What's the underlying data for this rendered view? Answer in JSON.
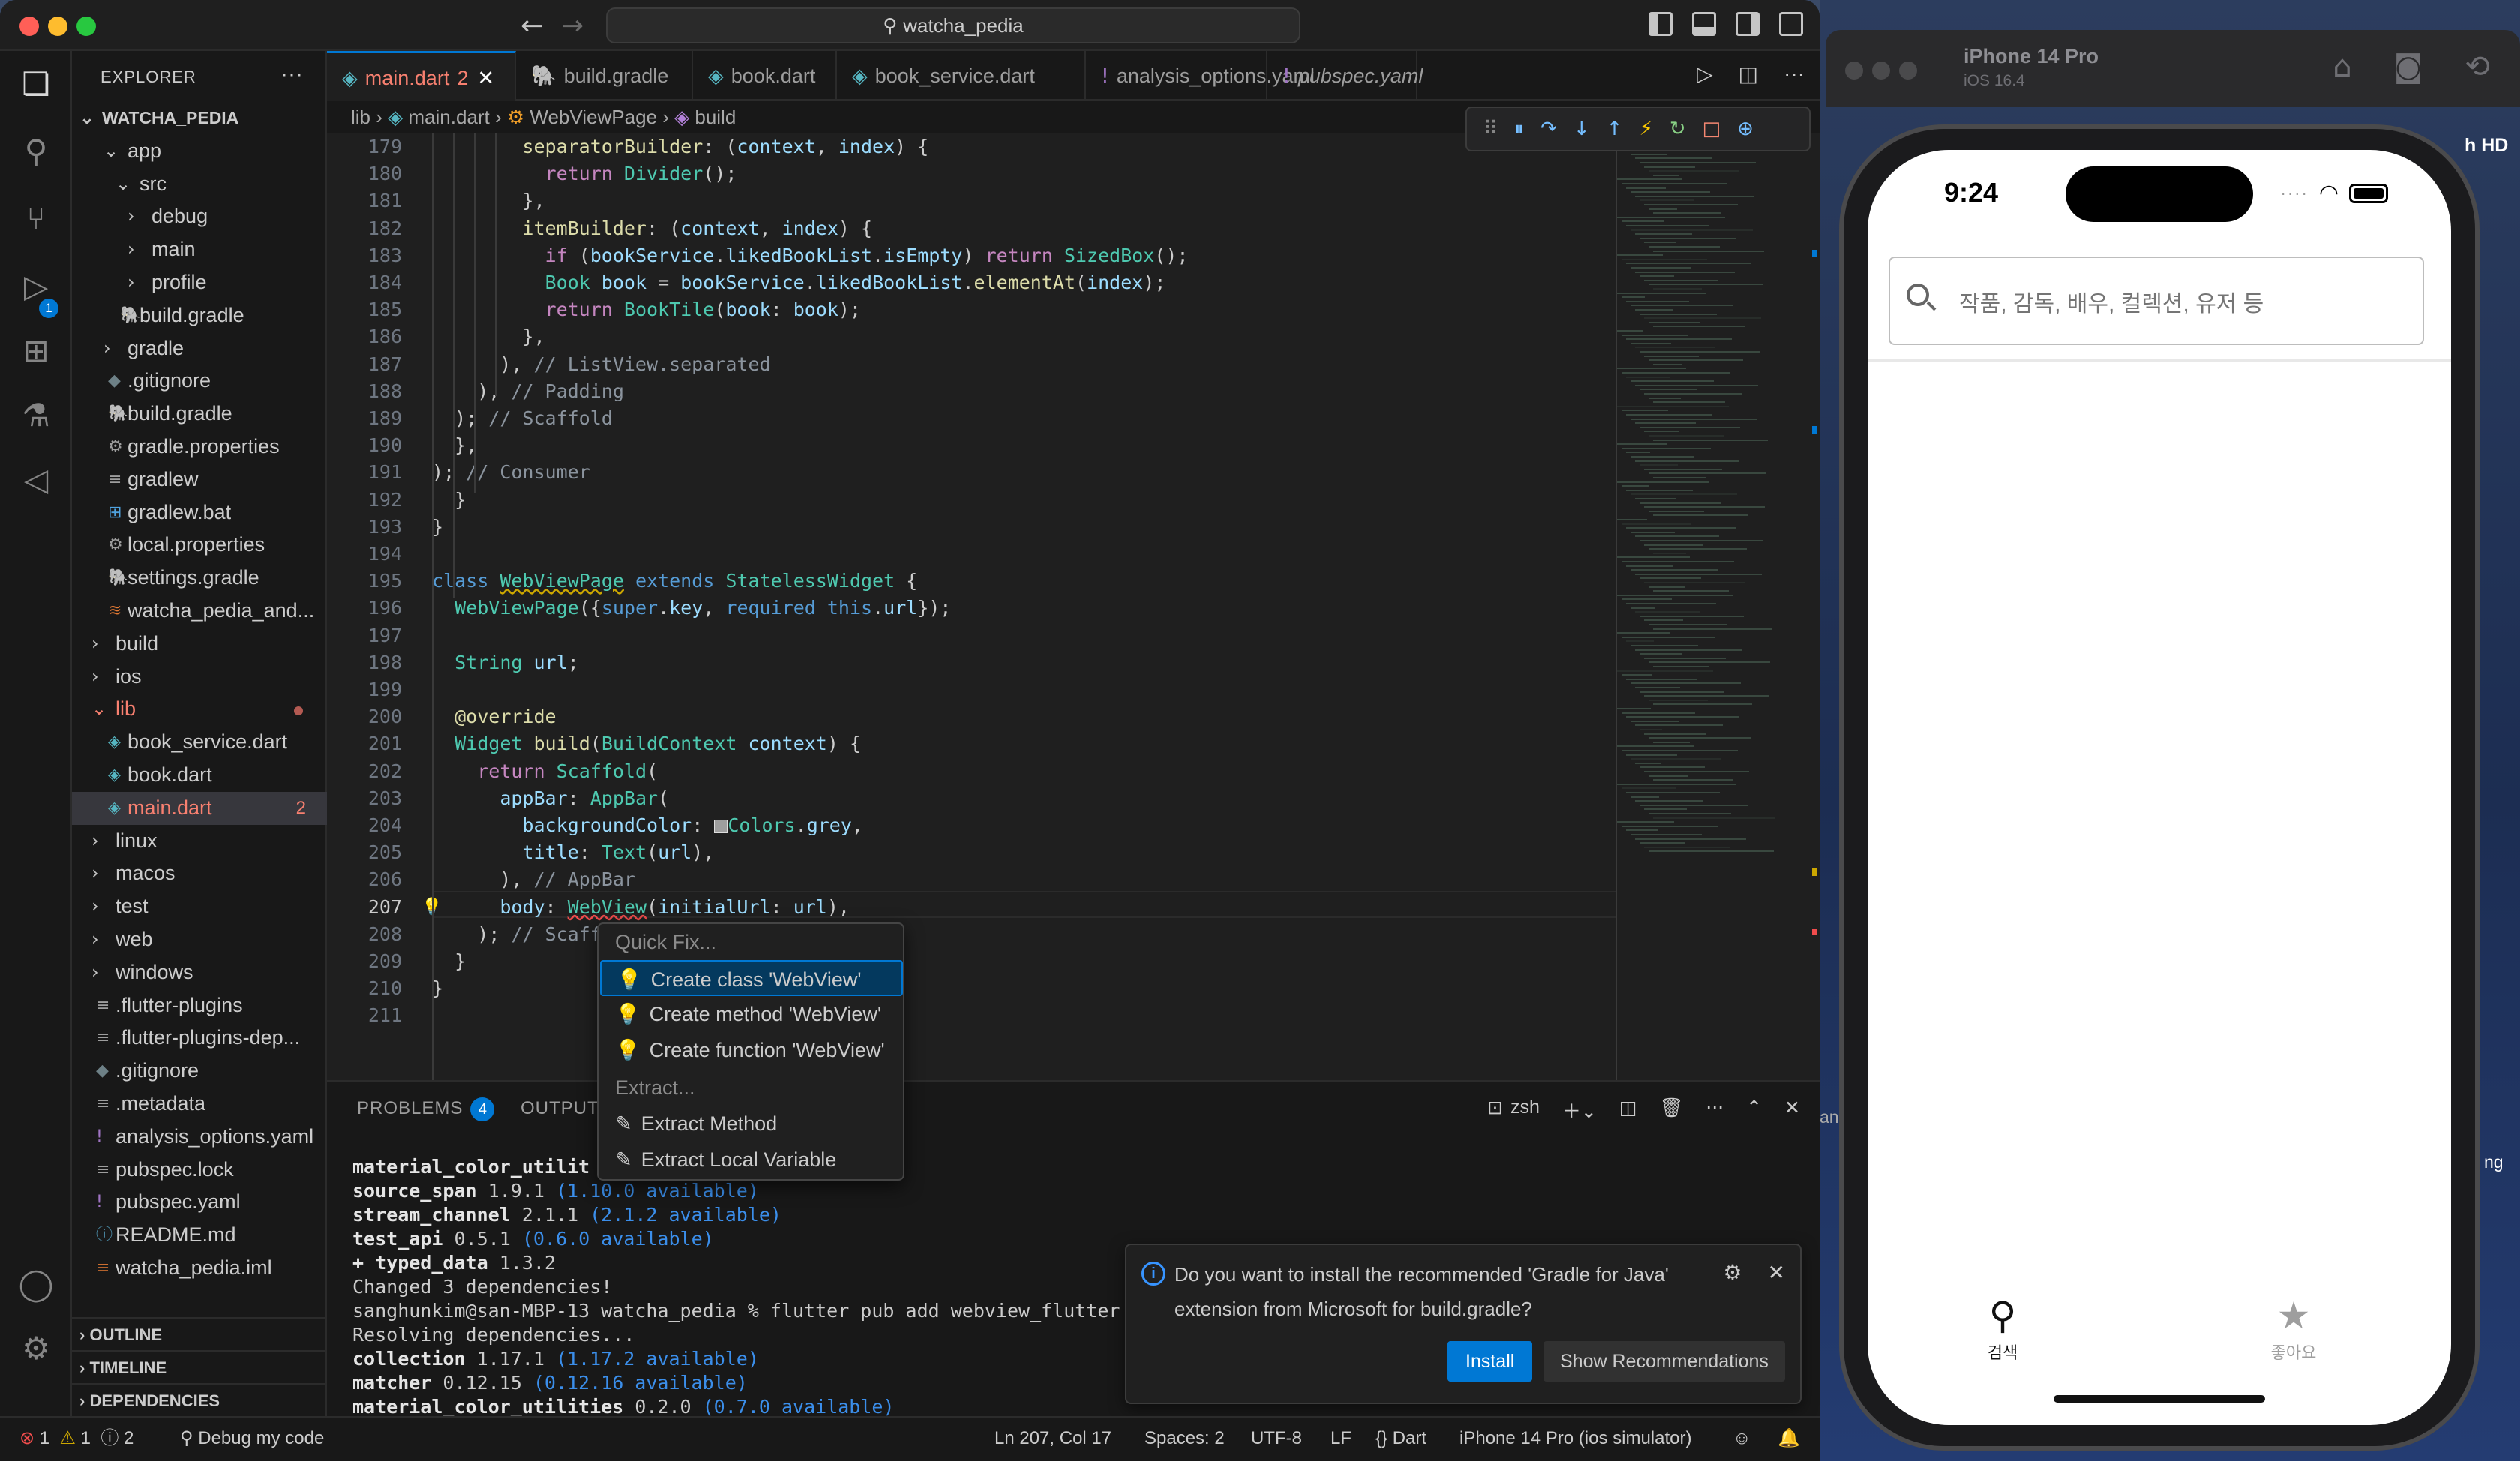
{
  "titlebar": {
    "command_center": "watcha_pedia",
    "back": "←",
    "forward": "→"
  },
  "explorer": {
    "header": "EXPLORER",
    "more": "···",
    "root": "WATCHA_PEDIA",
    "items": [
      {
        "label": "app",
        "indent": 1,
        "kind": "folder-open"
      },
      {
        "label": "src",
        "indent": 2,
        "kind": "folder-open"
      },
      {
        "label": "debug",
        "indent": 3,
        "kind": "folder"
      },
      {
        "label": "main",
        "indent": 3,
        "kind": "folder"
      },
      {
        "label": "profile",
        "indent": 3,
        "kind": "folder"
      },
      {
        "label": "build.gradle",
        "indent": 2,
        "kind": "gradle"
      },
      {
        "label": "gradle",
        "indent": 1,
        "kind": "folder"
      },
      {
        "label": ".gitignore",
        "indent": 1,
        "kind": "gitignore"
      },
      {
        "label": "build.gradle",
        "indent": 1,
        "kind": "gradle"
      },
      {
        "label": "gradle.properties",
        "indent": 1,
        "kind": "gear"
      },
      {
        "label": "gradlew",
        "indent": 1,
        "kind": "lines"
      },
      {
        "label": "gradlew.bat",
        "indent": 1,
        "kind": "windows"
      },
      {
        "label": "local.properties",
        "indent": 1,
        "kind": "gear"
      },
      {
        "label": "settings.gradle",
        "indent": 1,
        "kind": "gradle"
      },
      {
        "label": "watcha_pedia_and...",
        "indent": 1,
        "kind": "rss"
      },
      {
        "label": "build",
        "indent": 0,
        "kind": "folder"
      },
      {
        "label": "ios",
        "indent": 0,
        "kind": "folder"
      },
      {
        "label": "lib",
        "indent": 0,
        "kind": "folder-open-red"
      },
      {
        "label": "book_service.dart",
        "indent": 1,
        "kind": "dart"
      },
      {
        "label": "book.dart",
        "indent": 1,
        "kind": "dart"
      },
      {
        "label": "main.dart",
        "indent": 1,
        "kind": "dart-selected",
        "badge": "2"
      },
      {
        "label": "linux",
        "indent": 0,
        "kind": "folder"
      },
      {
        "label": "macos",
        "indent": 0,
        "kind": "folder"
      },
      {
        "label": "test",
        "indent": 0,
        "kind": "folder"
      },
      {
        "label": "web",
        "indent": 0,
        "kind": "folder"
      },
      {
        "label": "windows",
        "indent": 0,
        "kind": "folder"
      },
      {
        "label": ".flutter-plugins",
        "indent": 0,
        "kind": "lines"
      },
      {
        "label": ".flutter-plugins-dep...",
        "indent": 0,
        "kind": "lines"
      },
      {
        "label": ".gitignore",
        "indent": 0,
        "kind": "gitignore"
      },
      {
        "label": ".metadata",
        "indent": 0,
        "kind": "lines"
      },
      {
        "label": "analysis_options.yaml",
        "indent": 0,
        "kind": "yaml"
      },
      {
        "label": "pubspec.lock",
        "indent": 0,
        "kind": "lines"
      },
      {
        "label": "pubspec.yaml",
        "indent": 0,
        "kind": "yaml"
      },
      {
        "label": "README.md",
        "indent": 0,
        "kind": "info"
      },
      {
        "label": "watcha_pedia.iml",
        "indent": 0,
        "kind": "lines-orange"
      }
    ],
    "sections": [
      "OUTLINE",
      "TIMELINE",
      "DEPENDENCIES"
    ]
  },
  "tabs": [
    {
      "label": "main.dart",
      "suffix": "2",
      "active": true
    },
    {
      "label": "build.gradle"
    },
    {
      "label": "book.dart"
    },
    {
      "label": "book_service.dart"
    },
    {
      "label": "analysis_options.yaml"
    },
    {
      "label": "pubspec.yaml"
    }
  ],
  "breadcrumb": {
    "p1": "lib",
    "p2": "main.dart",
    "p3": "WebViewPage",
    "p4": "build"
  },
  "editor": {
    "current_line": "207",
    "lines": [
      {
        "n": "179"
      },
      {
        "n": "180"
      },
      {
        "n": "181"
      },
      {
        "n": "182"
      },
      {
        "n": "183"
      },
      {
        "n": "184"
      },
      {
        "n": "185"
      },
      {
        "n": "186"
      },
      {
        "n": "187"
      },
      {
        "n": "188"
      },
      {
        "n": "189"
      },
      {
        "n": "190"
      },
      {
        "n": "191"
      },
      {
        "n": "192"
      },
      {
        "n": "193"
      },
      {
        "n": "194"
      },
      {
        "n": "195"
      },
      {
        "n": "196"
      },
      {
        "n": "197"
      },
      {
        "n": "198"
      },
      {
        "n": "199"
      },
      {
        "n": "200"
      },
      {
        "n": "201"
      },
      {
        "n": "202"
      },
      {
        "n": "203"
      },
      {
        "n": "204"
      },
      {
        "n": "205"
      },
      {
        "n": "206"
      },
      {
        "n": "207"
      },
      {
        "n": "208"
      },
      {
        "n": "209"
      },
      {
        "n": "210"
      },
      {
        "n": "211"
      }
    ]
  },
  "quickfix": {
    "header": "Quick Fix...",
    "items": [
      "Create class 'WebView'",
      "Create method 'WebView'",
      "Create function 'WebView'"
    ],
    "extract_header": "Extract...",
    "extract_items": [
      "Extract Method",
      "Extract Local Variable"
    ]
  },
  "panel": {
    "tabs": [
      "PROBLEMS",
      "OUTPUT"
    ],
    "problems_count": "4",
    "shell": "zsh",
    "terminal": [
      {
        "pkg": "material_color_utilit",
        "ver": "",
        "avail": ""
      },
      {
        "pkg": "source_span",
        "ver": "1.9.1",
        "avail": "(1.10.0 available)"
      },
      {
        "pkg": "stream_channel",
        "ver": "2.1.1",
        "avail": "(2.1.2 available)"
      },
      {
        "pkg": "test_api",
        "ver": "0.5.1",
        "avail": "(0.6.0 available)"
      },
      {
        "pkg": "+ typed_data",
        "ver": "1.3.2",
        "avail": ""
      }
    ],
    "changed": "Changed 3 dependencies!",
    "prompt": "sanghunkim@san-MBP-13 watcha_pedia % flutter pub add webview_flutter",
    "resolving": "Resolving dependencies...",
    "terminal2": [
      {
        "pkg": "collection",
        "ver": "1.17.1",
        "avail": "(1.17.2 available)"
      },
      {
        "pkg": "matcher",
        "ver": "0.12.15",
        "avail": "(0.12.16 available)"
      },
      {
        "pkg": "material_color_utilities",
        "ver": "0.2.0",
        "avail": "(0.7.0 available)"
      }
    ]
  },
  "notification": {
    "message": "Do you want to install the recommended 'Gradle for Java' extension from Microsoft for build.gradle?",
    "install": "Install",
    "show_recommendations": "Show Recommendations"
  },
  "statusbar": {
    "errors": "1",
    "warnings": "1",
    "infos": "2",
    "debug": "Debug my code",
    "position": "Ln 207, Col 17",
    "spaces": "Spaces: 2",
    "encoding": "UTF-8",
    "eol": "LF",
    "language": "Dart",
    "device": "iPhone 14 Pro (ios simulator)"
  },
  "simulator": {
    "device": "iPhone 14 Pro",
    "os": "iOS 16.4",
    "side_hd": "h HD",
    "side_an": "an",
    "side_ng": "ng",
    "time": "9:24",
    "search_placeholder": "작품, 감독, 배우, 컬렉션, 유저 등",
    "nav": [
      {
        "label": "검색",
        "icon": "search-icon",
        "active": true
      },
      {
        "label": "좋아요",
        "icon": "star-icon",
        "active": false
      }
    ]
  },
  "colors": {
    "accent": "#0078d4",
    "error": "#f88070",
    "bulb": "#ffcc00"
  }
}
